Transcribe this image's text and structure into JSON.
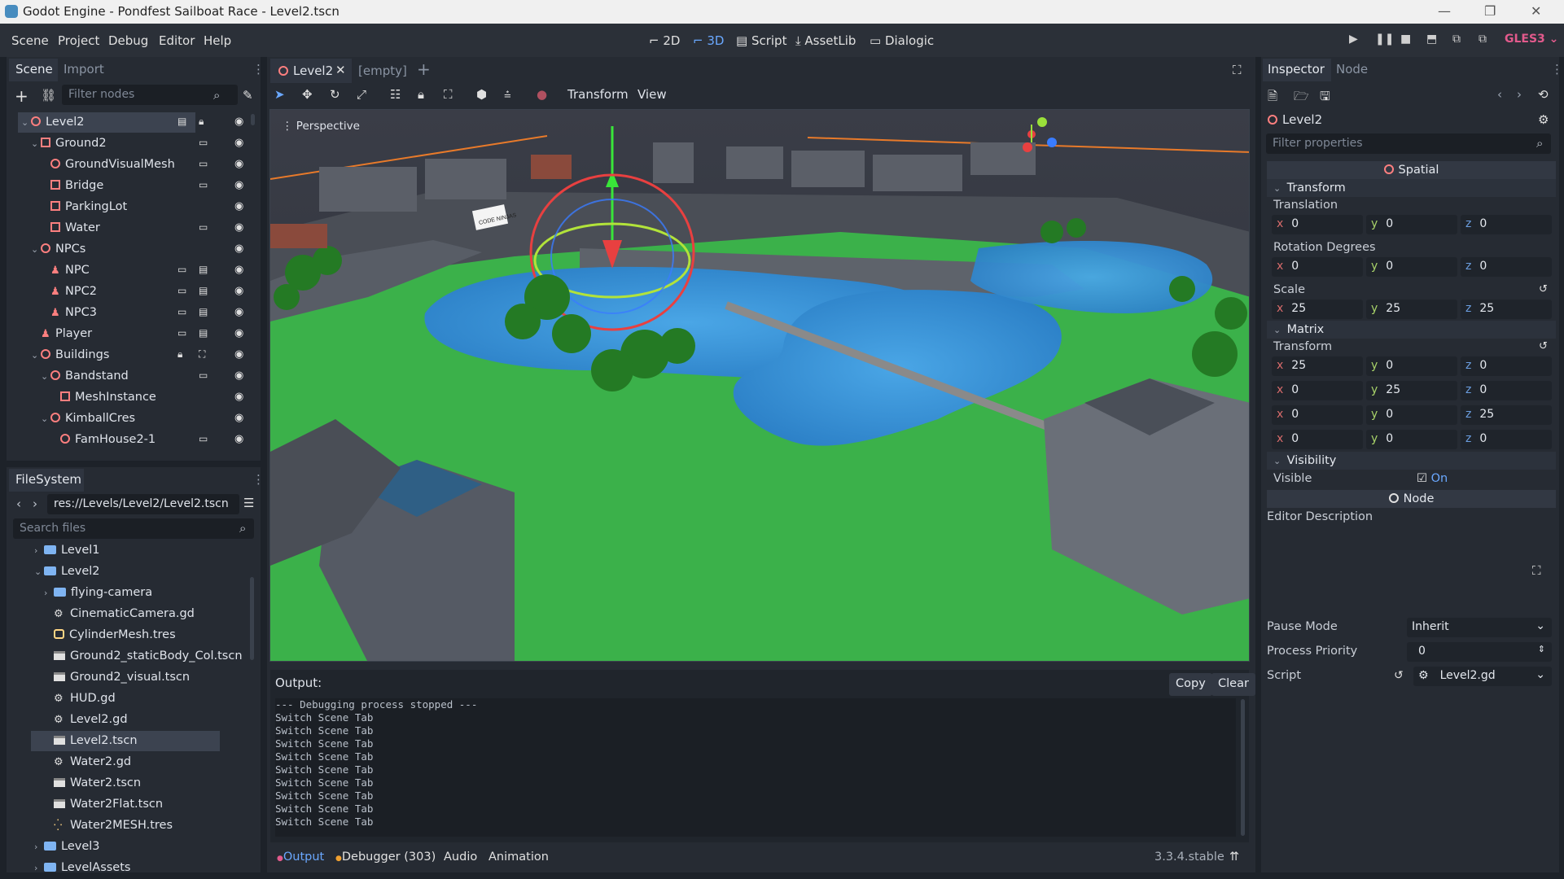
{
  "window": {
    "title": "Godot Engine - Pondfest Sailboat Race - Level2.tscn"
  },
  "menu": [
    "Scene",
    "Project",
    "Debug",
    "Editor",
    "Help"
  ],
  "workspaces": [
    {
      "label": "2D",
      "icon": "2d-icon",
      "active": false
    },
    {
      "label": "3D",
      "icon": "3d-icon",
      "active": true
    },
    {
      "label": "Script",
      "icon": "script-icon",
      "active": false
    },
    {
      "label": "AssetLib",
      "icon": "assetlib-icon",
      "active": false
    },
    {
      "label": "Dialogic",
      "icon": "dialogic-icon",
      "active": false
    }
  ],
  "renderer": "GLES3",
  "scene_dock": {
    "tabs": [
      "Scene",
      "Import"
    ],
    "filter_placeholder": "Filter nodes",
    "tree": [
      {
        "label": "Level2",
        "icon": "spatial-icon",
        "depth": 0,
        "arrow": "v",
        "selected": true,
        "extras": [
          "script",
          "lock"
        ]
      },
      {
        "label": "Ground2",
        "icon": "csg-icon",
        "depth": 1,
        "arrow": "v",
        "extras": [
          "clapper"
        ]
      },
      {
        "label": "GroundVisualMesh",
        "icon": "spatial-icon",
        "depth": 2,
        "arrow": "",
        "extras": [
          "clapper"
        ]
      },
      {
        "label": "Bridge",
        "icon": "mesh-icon",
        "depth": 2,
        "arrow": "",
        "extras": [
          "clapper"
        ]
      },
      {
        "label": "ParkingLot",
        "icon": "mesh-icon",
        "depth": 2,
        "arrow": "",
        "extras": []
      },
      {
        "label": "Water",
        "icon": "mesh-icon",
        "depth": 2,
        "arrow": "",
        "extras": [
          "clapper"
        ]
      },
      {
        "label": "NPCs",
        "icon": "spatial-icon",
        "depth": 1,
        "arrow": "v",
        "extras": []
      },
      {
        "label": "NPC",
        "icon": "character-icon",
        "depth": 2,
        "arrow": "",
        "extras": [
          "clapper",
          "script"
        ]
      },
      {
        "label": "NPC2",
        "icon": "character-icon",
        "depth": 2,
        "arrow": "",
        "extras": [
          "clapper",
          "script"
        ]
      },
      {
        "label": "NPC3",
        "icon": "character-icon",
        "depth": 2,
        "arrow": "",
        "extras": [
          "clapper",
          "script"
        ]
      },
      {
        "label": "Player",
        "icon": "character-icon",
        "depth": 1,
        "arrow": "",
        "extras": [
          "clapper",
          "script"
        ]
      },
      {
        "label": "Buildings",
        "icon": "spatial-icon",
        "depth": 1,
        "arrow": "v",
        "extras": [
          "lock",
          "group"
        ]
      },
      {
        "label": "Bandstand",
        "icon": "spatial-icon",
        "depth": 2,
        "arrow": "v",
        "extras": [
          "clapper"
        ]
      },
      {
        "label": "MeshInstance",
        "icon": "mesh-icon",
        "depth": 3,
        "arrow": "",
        "extras": []
      },
      {
        "label": "KimballCres",
        "icon": "spatial-icon",
        "depth": 2,
        "arrow": "v",
        "extras": []
      },
      {
        "label": "FamHouse2-1",
        "icon": "spatial-icon",
        "depth": 3,
        "arrow": "",
        "extras": [
          "clapper"
        ]
      }
    ]
  },
  "filesystem": {
    "title": "FileSystem",
    "path": "res://Levels/Level2/Level2.tscn",
    "search_placeholder": "Search files",
    "items": [
      {
        "label": "Level1",
        "type": "folder",
        "depth": 0,
        "arrow": ">"
      },
      {
        "label": "Level2",
        "type": "folder",
        "depth": 0,
        "arrow": "v"
      },
      {
        "label": "flying-camera",
        "type": "folder",
        "depth": 1,
        "arrow": ">"
      },
      {
        "label": "CinematicCamera.gd",
        "type": "script",
        "depth": 1,
        "arrow": ""
      },
      {
        "label": "CylinderMesh.tres",
        "type": "resource",
        "depth": 1,
        "arrow": ""
      },
      {
        "label": "Ground2_staticBody_Col.tscn",
        "type": "scene",
        "depth": 1,
        "arrow": ""
      },
      {
        "label": "Ground2_visual.tscn",
        "type": "scene",
        "depth": 1,
        "arrow": ""
      },
      {
        "label": "HUD.gd",
        "type": "script",
        "depth": 1,
        "arrow": ""
      },
      {
        "label": "Level2.gd",
        "type": "script",
        "depth": 1,
        "arrow": ""
      },
      {
        "label": "Level2.tscn",
        "type": "scene",
        "depth": 1,
        "arrow": "",
        "selected": true
      },
      {
        "label": "Water2.gd",
        "type": "script",
        "depth": 1,
        "arrow": ""
      },
      {
        "label": "Water2.tscn",
        "type": "scene",
        "depth": 1,
        "arrow": ""
      },
      {
        "label": "Water2Flat.tscn",
        "type": "scene",
        "depth": 1,
        "arrow": ""
      },
      {
        "label": "Water2MESH.tres",
        "type": "mesh",
        "depth": 1,
        "arrow": ""
      },
      {
        "label": "Level3",
        "type": "folder",
        "depth": 0,
        "arrow": ">"
      },
      {
        "label": "LevelAssets",
        "type": "folder",
        "depth": 0,
        "arrow": ">"
      }
    ]
  },
  "editor_tabs": [
    {
      "label": "Level2",
      "active": true
    },
    {
      "label": "[empty]",
      "active": false
    }
  ],
  "viewport_toolbar": {
    "transform_label": "Transform",
    "view_label": "View"
  },
  "viewport": {
    "label": "Perspective",
    "sign_text": "CODE NINJAS"
  },
  "output": {
    "title": "Output:",
    "copy_label": "Copy",
    "clear_label": "Clear",
    "lines": [
      "--- Debugging process stopped ---",
      "Switch Scene Tab",
      "Switch Scene Tab",
      "Switch Scene Tab",
      "Switch Scene Tab",
      "Switch Scene Tab",
      "Switch Scene Tab",
      "Switch Scene Tab",
      "Switch Scene Tab",
      "Switch Scene Tab"
    ]
  },
  "bottom_bar": {
    "output": "Output",
    "debugger": "Debugger (303)",
    "audio": "Audio",
    "animation": "Animation",
    "version": "3.3.4.stable"
  },
  "inspector": {
    "tabs": [
      "Inspector",
      "Node"
    ],
    "node_name": "Level2",
    "filter_placeholder": "Filter properties",
    "class_spatial": "Spatial",
    "transform_section": "Transform",
    "translation_label": "Translation",
    "translation": {
      "x": "0",
      "y": "0",
      "z": "0"
    },
    "rotation_label": "Rotation Degrees",
    "rotation": {
      "x": "0",
      "y": "0",
      "z": "0"
    },
    "scale_label": "Scale",
    "scale": {
      "x": "25",
      "y": "25",
      "z": "25"
    },
    "matrix_section": "Matrix",
    "matrix_transform_label": "Transform",
    "matrix": [
      {
        "a": "25",
        "b": "0",
        "c": "0"
      },
      {
        "a": "0",
        "b": "25",
        "c": "0"
      },
      {
        "a": "0",
        "b": "0",
        "c": "25"
      },
      {
        "a": "0",
        "b": "0",
        "c": "0"
      }
    ],
    "visibility_section": "Visibility",
    "visible_label": "Visible",
    "visible_value": "On",
    "class_node": "Node",
    "editor_description_label": "Editor Description",
    "pause_mode_label": "Pause Mode",
    "pause_mode_value": "Inherit",
    "process_priority_label": "Process Priority",
    "process_priority_value": "0",
    "script_label": "Script",
    "script_value": "Level2.gd"
  },
  "colors": {
    "accent": "#6aa8ff",
    "node_red": "#fc7f7f",
    "gles": "#e25a8c"
  }
}
